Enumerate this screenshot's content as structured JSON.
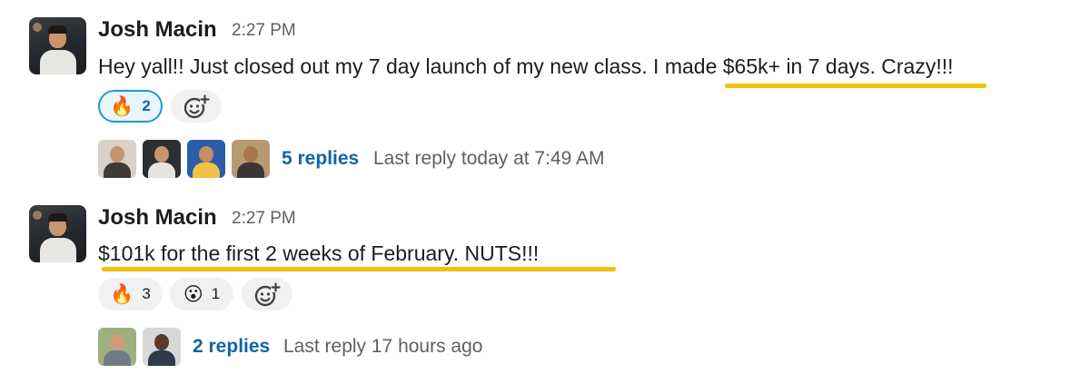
{
  "colors": {
    "highlight": "#f4c20d",
    "link": "#1264a3",
    "active_reaction_border": "#1d9bd1"
  },
  "messages": [
    {
      "author": "Josh Macin",
      "time": "2:27 PM",
      "text_before": "Hey yall!! Just closed out my 7 day launch of my new class. I ",
      "text_highlight": "made $65k+ in 7 days. Crazy",
      "text_after": "!!!",
      "reactions": [
        {
          "emoji": "🔥",
          "icon": "fire-icon",
          "count": "2",
          "active": true
        }
      ],
      "add_reaction_icon": "add-reaction-icon",
      "replies": "5 replies",
      "last_reply": "Last reply today at 7:49 AM"
    },
    {
      "author": "Josh Macin",
      "time": "2:27 PM",
      "text_before": "",
      "text_highlight": "$101k for the first 2 weeks of February. NUTS!!!",
      "text_after": "",
      "reactions": [
        {
          "emoji": "🔥",
          "icon": "fire-icon",
          "count": "3",
          "active": false
        },
        {
          "emoji": "😮",
          "icon": "surprised-face-icon",
          "count": "1",
          "active": false
        }
      ],
      "add_reaction_icon": "add-reaction-icon",
      "replies": "2 replies",
      "last_reply": "Last reply 17 hours ago"
    }
  ]
}
